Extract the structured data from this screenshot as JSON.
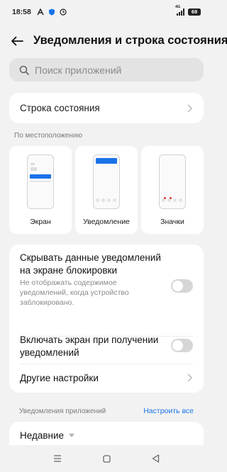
{
  "status_bar": {
    "time": "18:58",
    "network": "4G",
    "battery": "69"
  },
  "header": {
    "title": "Уведомления и строка состояния"
  },
  "search": {
    "placeholder": "Поиск приложений"
  },
  "status_bar_row": {
    "label": "Строка состояния"
  },
  "location_section": {
    "label": "По местоположению",
    "tiles": [
      {
        "label": "Экран"
      },
      {
        "label": "Уведомление"
      },
      {
        "label": "Значки"
      }
    ]
  },
  "settings": {
    "hide_data": {
      "title": "Скрывать данные уведомлений на экране блокировки",
      "description": "Не отображать содержимое уведомлений, когда устройство заблокировано.",
      "enabled": false
    },
    "wake_screen": {
      "title": "Включать экран при получении уведомлений",
      "enabled": false
    },
    "other": {
      "label": "Другие настройки"
    }
  },
  "app_notifications": {
    "label": "Уведомления приложений",
    "configure_all": "Настроить все",
    "sort": "Недавние"
  },
  "colors": {
    "accent": "#1a73e8",
    "badge_red": "#e53935"
  }
}
